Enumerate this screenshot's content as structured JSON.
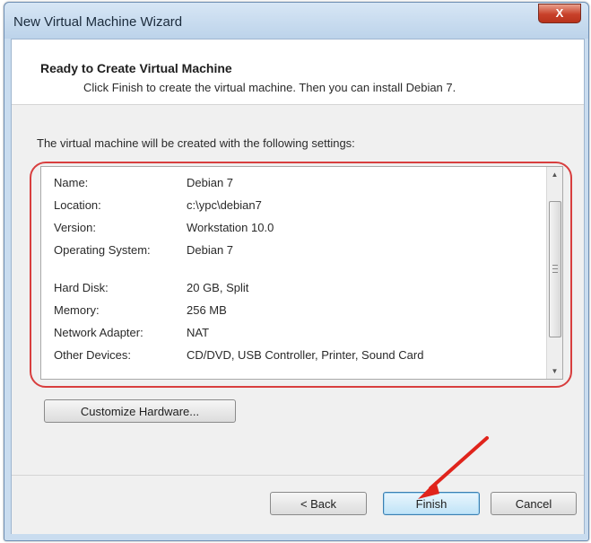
{
  "window": {
    "title": "New Virtual Machine Wizard",
    "close_glyph": "X"
  },
  "header": {
    "title": "Ready to Create Virtual Machine",
    "description": "Click Finish to create the virtual machine. Then you can install Debian 7."
  },
  "body": {
    "intro": "The virtual machine will be created with the following settings:",
    "settings": [
      {
        "label": "Name:",
        "value": "Debian 7"
      },
      {
        "label": "Location:",
        "value": "c:\\ypc\\debian7"
      },
      {
        "label": "Version:",
        "value": "Workstation 10.0"
      },
      {
        "label": "Operating System:",
        "value": "Debian 7"
      },
      {
        "label": "Hard Disk:",
        "value": "20 GB, Split"
      },
      {
        "label": "Memory:",
        "value": "256 MB"
      },
      {
        "label": "Network Adapter:",
        "value": "NAT"
      },
      {
        "label": "Other Devices:",
        "value": "CD/DVD, USB Controller, Printer, Sound Card"
      }
    ],
    "customize_button": "Customize Hardware..."
  },
  "footer": {
    "back_button": "< Back",
    "finish_button": "Finish",
    "cancel_button": "Cancel"
  },
  "annotations": {
    "highlight_color": "#d83e3e",
    "arrow_color": "#e0241c"
  }
}
